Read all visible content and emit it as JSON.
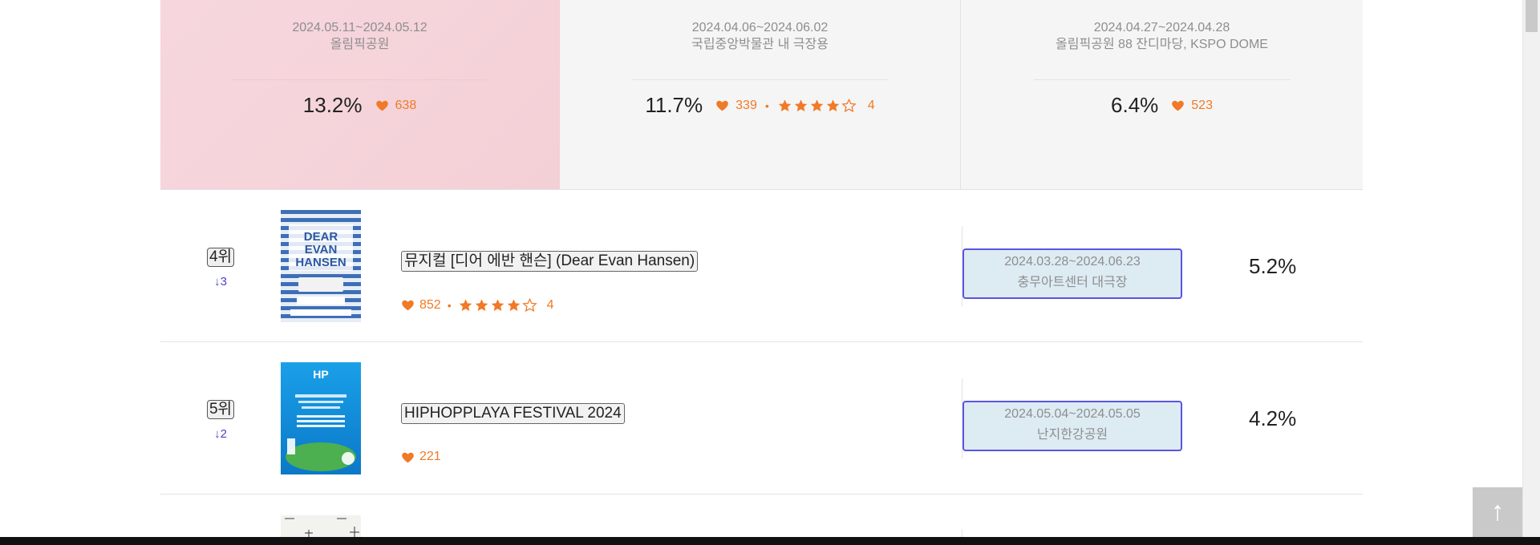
{
  "top_cards": [
    {
      "date": "2024.05.11~2024.05.12",
      "venue": "올림픽공원",
      "percent": "13.2%",
      "likes": "638"
    },
    {
      "date": "2024.04.06~2024.06.02",
      "venue": "국립중앙박물관 내 극장용",
      "percent": "11.7%",
      "likes": "339",
      "rating": "4",
      "stars_filled": 4
    },
    {
      "date": "2024.04.27~2024.04.28",
      "venue": "올림픽공원 88 잔디마당, KSPO DOME",
      "percent": "6.4%",
      "likes": "523"
    }
  ],
  "rows": [
    {
      "rank": "4위",
      "change": "↓3",
      "title": "뮤지컬 [디어 에반 핸슨] (Dear Evan Hansen)",
      "likes": "852",
      "rating": "4",
      "stars_filled": 4,
      "date": "2024.03.28~2024.06.23",
      "venue": "충무아트센터 대극장",
      "percent": "5.2%",
      "poster_text": [
        "DEAR",
        "EVAN",
        "HANSEN"
      ]
    },
    {
      "rank": "5위",
      "change": "↓2",
      "title": "HIPHOPPLAYA FESTIVAL 2024",
      "likes": "221",
      "date": "2024.05.04~2024.05.05",
      "venue": "난지한강공원",
      "percent": "4.2%",
      "poster_text": [
        "HP"
      ]
    }
  ],
  "scroll_top_label": "↑",
  "colors": {
    "accent": "#f07a26",
    "rank_change": "#4a44c9",
    "date_box_border": "#5a54e0",
    "date_box_bg": "#ddebf3",
    "card_highlight": "#f7d7de"
  }
}
